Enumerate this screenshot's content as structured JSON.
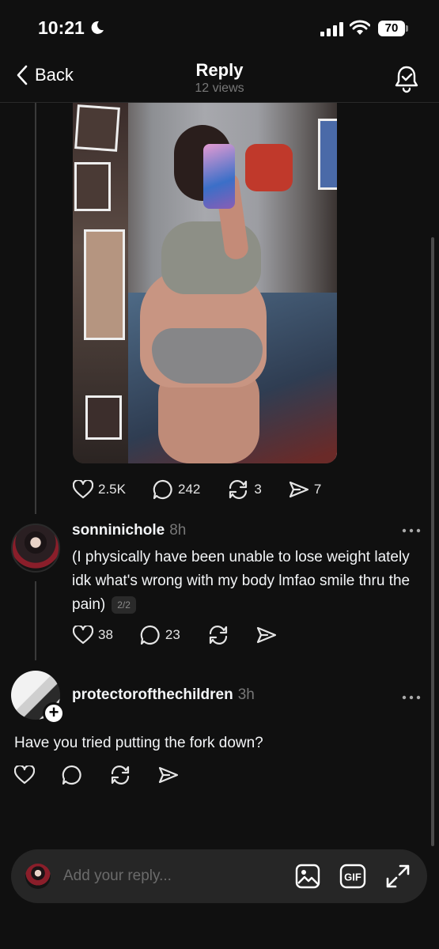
{
  "status_bar": {
    "time": "10:21",
    "battery": "70"
  },
  "nav": {
    "back_label": "Back",
    "title": "Reply",
    "views": "12 views"
  },
  "post": {
    "likes": "2.5K",
    "comments": "242",
    "reposts": "3",
    "shares": "7"
  },
  "reply1": {
    "username": "sonninichole",
    "time": "8h",
    "text": "(I physically have been unable to lose weight lately idk what's wrong with my body lmfao smile thru the pain)",
    "pager": "2/2",
    "likes": "38",
    "comments": "23"
  },
  "reply2": {
    "username": "protectorofthechildren",
    "time": "3h",
    "text": "Have you tried putting the fork down?"
  },
  "composer": {
    "placeholder": "Add your reply..."
  },
  "icons": {
    "back": "chevron-left-icon",
    "notify": "bell-check-icon",
    "like": "heart-icon",
    "comment": "speech-bubble-icon",
    "repost": "repost-icon",
    "share": "send-icon",
    "more": "more-dots-icon",
    "image": "image-icon",
    "gif": "gif-icon",
    "expand": "expand-icon"
  }
}
